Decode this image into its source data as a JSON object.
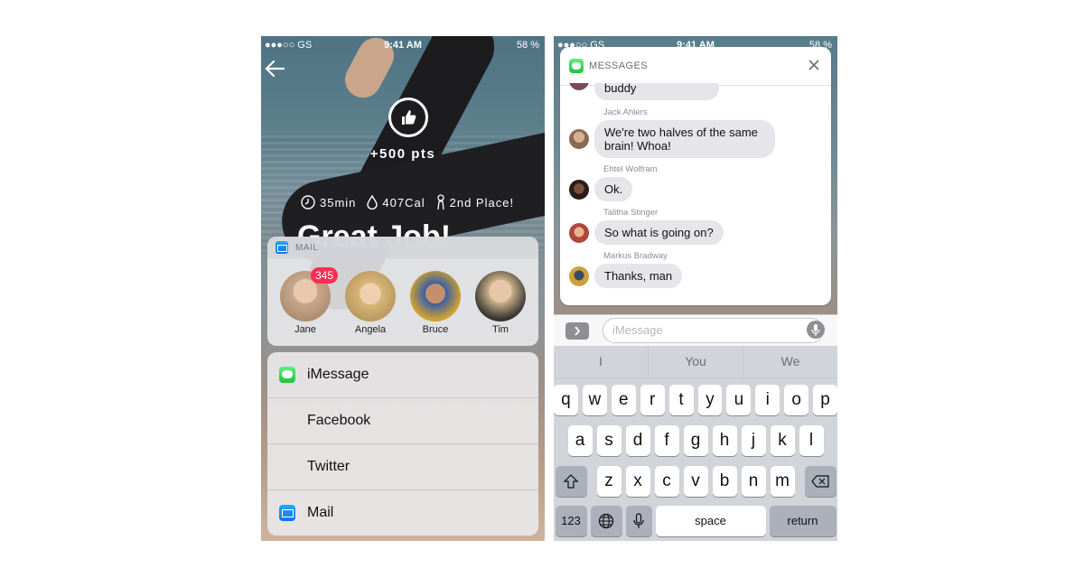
{
  "left_phone": {
    "status": {
      "carrier": "●●●○○ GS",
      "time": "9:41 AM",
      "battery": "58 %"
    },
    "points": "+500 pts",
    "stats": [
      {
        "icon": "clock-icon",
        "value": "35min"
      },
      {
        "icon": "drop-icon",
        "value": "407Cal"
      },
      {
        "icon": "trophy-icon",
        "value": "2nd Place!"
      }
    ],
    "headline": "Great Job!",
    "mail_card": {
      "title": "MAIL",
      "badge": "345",
      "contacts": [
        {
          "name": "Jane",
          "color": "#c9a88a"
        },
        {
          "name": "Angela",
          "color": "#d9b678"
        },
        {
          "name": "Bruce",
          "color": "#3a5ea8"
        },
        {
          "name": "Tim",
          "color": "#6b6357"
        }
      ]
    },
    "share_options": [
      {
        "label": "iMessage",
        "icon": "imessage-icon"
      },
      {
        "label": "Facebook",
        "icon": ""
      },
      {
        "label": "Twitter",
        "icon": ""
      },
      {
        "label": "Mail",
        "icon": "mail-icon"
      }
    ]
  },
  "right_phone": {
    "status": {
      "carrier": "●●●○○ GS",
      "time": "9:41 AM",
      "battery": "58 %"
    },
    "messages_card": {
      "title": "MESSAGES",
      "thread": [
        {
          "sender": "",
          "text": "buddy",
          "avatar_color": "#7a4a5a"
        },
        {
          "sender": "Jack Ahlers",
          "text": "We're two halves of the same brain! Whoa!",
          "avatar_color": "#8a6a55"
        },
        {
          "sender": "Ehtel Wolfram",
          "text": "Ok.",
          "avatar_color": "#3d2a22"
        },
        {
          "sender": "Talitha Stinger",
          "text": "So what is going on?",
          "avatar_color": "#b0463a"
        },
        {
          "sender": "Markus Bradway",
          "text": "Thanks, man",
          "avatar_color": "#c9a23a"
        }
      ]
    },
    "input": {
      "placeholder": "iMessage"
    },
    "predictions": [
      "I",
      "You",
      "We"
    ],
    "keyboard": {
      "row1": [
        "q",
        "w",
        "e",
        "r",
        "t",
        "y",
        "u",
        "i",
        "o",
        "p"
      ],
      "row2": [
        "a",
        "s",
        "d",
        "f",
        "g",
        "h",
        "j",
        "k",
        "l"
      ],
      "row3": [
        "z",
        "x",
        "c",
        "v",
        "b",
        "n",
        "m"
      ],
      "numbers": "123",
      "space": "space",
      "return": "return"
    }
  }
}
